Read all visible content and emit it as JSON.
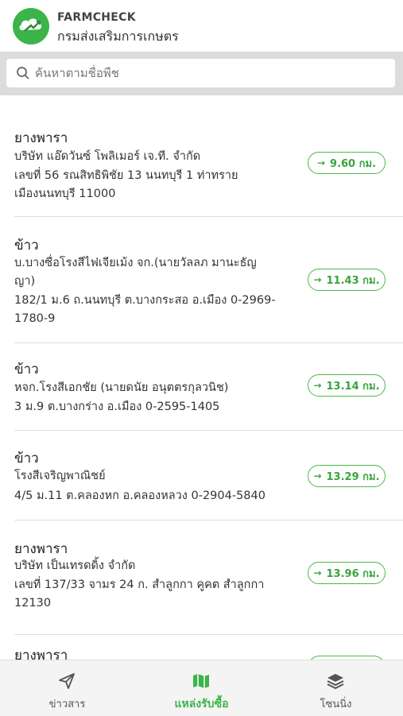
{
  "header": {
    "brand_en": "FARMCHECK",
    "brand_th": "กรมส่งเสริมการเกษตร"
  },
  "search": {
    "placeholder": "ค้นหาตามชื่อพืช"
  },
  "items": [
    {
      "type": "ยางพารา",
      "lines": [
        "บริษัท แอ๊ดวันซ์ โพลิเมอร์ เจ.ที. จำกัด",
        "เลขที่ 56 รณสิทธิพิชัย 13 นนทบุรี 1 ท่าทราย",
        "เมืองนนทบุรี 11000"
      ],
      "distance": "9.60 กม."
    },
    {
      "type": "ข้าว",
      "lines": [
        "บ.บางซื่อโรงสีไฟเจียเม้ง จก.(นายวัลลภ มานะธัญ",
        "ญา)",
        "182/1 ม.6 ถ.นนทบุรี ต.บางกระสอ อ.เมือง 0-2969-",
        "1780-9"
      ],
      "distance": "11.43 กม."
    },
    {
      "type": "ข้าว",
      "lines": [
        "หจก.โรงสีเอกชัย (นายดนัย อนุตตรกุลวนิช)",
        "3 ม.9 ต.บางกร่าง อ.เมือง 0-2595-1405"
      ],
      "distance": "13.14 กม."
    },
    {
      "type": "ข้าว",
      "lines": [
        "โรงสีเจริญพาณิชย์",
        "4/5 ม.11 ต.คลองหก อ.คลองหลวง 0-2904-5840"
      ],
      "distance": "13.29 กม."
    },
    {
      "type": "ยางพารา",
      "lines": [
        "บริษัท เป็นเทรดดิ้ง จำกัด",
        "เลขที่ 137/33 จามร 24 ก. สำลูกกา คูคต สำลูกกา",
        "12130"
      ],
      "distance": "13.96 กม."
    },
    {
      "type": "ยางพารา",
      "lines": [],
      "distance": ""
    }
  ],
  "nav": {
    "news": "ข่าวสาร",
    "sources": "แหล่งรับซื้อ",
    "zoning": "โซนนิ่ง"
  },
  "colors": {
    "accent": "#3cb44a",
    "divider": "#dedede"
  }
}
